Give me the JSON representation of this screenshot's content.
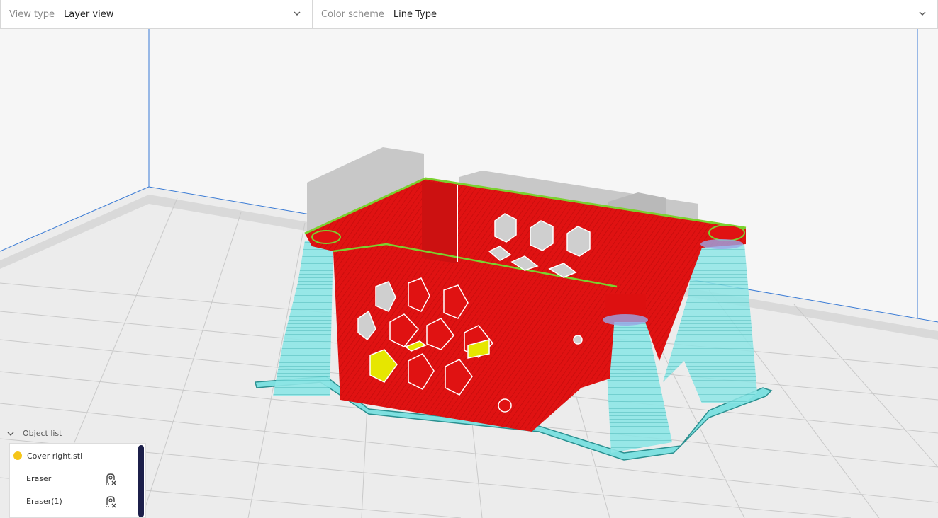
{
  "toolbar": {
    "view_type": {
      "label": "View type",
      "value": "Layer view"
    },
    "color_scheme": {
      "label": "Color scheme",
      "value": "Line Type"
    }
  },
  "object_list": {
    "title": "Object list",
    "items": [
      {
        "name": "Cover right.stl",
        "icon": "yellow-dot"
      },
      {
        "name": "Eraser",
        "icon": "eraser-support-icon"
      },
      {
        "name": "Eraser(1)",
        "icon": "eraser-support-icon"
      }
    ]
  },
  "colors": {
    "wall": "#dd1010",
    "support": "#7fe0e0",
    "skin": "#e6e600",
    "build_plate_grid": "#c8c8c8",
    "volume_edge": "#3a7bd5"
  }
}
